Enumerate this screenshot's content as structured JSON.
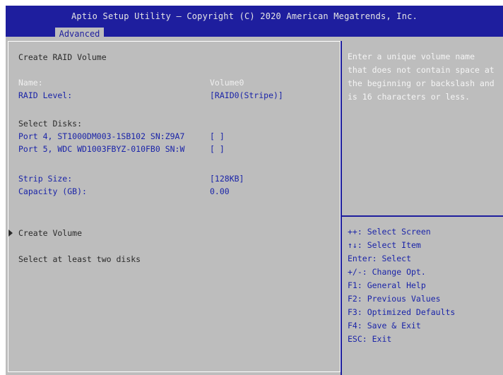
{
  "header": {
    "title": "Aptio Setup Utility – Copyright (C) 2020 American Megatrends, Inc.",
    "active_tab": "Advanced"
  },
  "left": {
    "section_title": "Create RAID Volume",
    "name_label": "Name:",
    "name_value": "Volume0",
    "raid_level_label": "RAID Level:",
    "raid_level_value": "[RAID0(Stripe)]",
    "select_disks_label": "Select Disks:",
    "disks": [
      {
        "label": "Port 4, ST1000DM003-1SB102 SN:Z9A7",
        "value": "[ ]"
      },
      {
        "label": "Port 5, WDC WD1003FBYZ-010FB0 SN:W",
        "value": "[ ]"
      }
    ],
    "strip_size_label": "Strip Size:",
    "strip_size_value": "[128KB]",
    "capacity_label": "Capacity (GB):",
    "capacity_value": "0.00",
    "create_volume_label": "Create Volume",
    "status_message": "Select at least two disks"
  },
  "help": {
    "lines": [
      "Enter a unique volume name",
      "that does not contain space at",
      "the beginning or backslash and",
      "is 16 characters or less."
    ]
  },
  "keys": [
    "++: Select Screen",
    "↑↓: Select Item",
    "Enter: Select",
    "+/-: Change Opt.",
    "F1: General Help",
    "F2: Previous Values",
    "F3: Optimized Defaults",
    "F4: Save & Exit",
    "ESC: Exit"
  ],
  "colors": {
    "header_bg": "#1e1e9e",
    "panel_bg": "#bdbdbd",
    "accent_blue": "#1a24a8"
  }
}
